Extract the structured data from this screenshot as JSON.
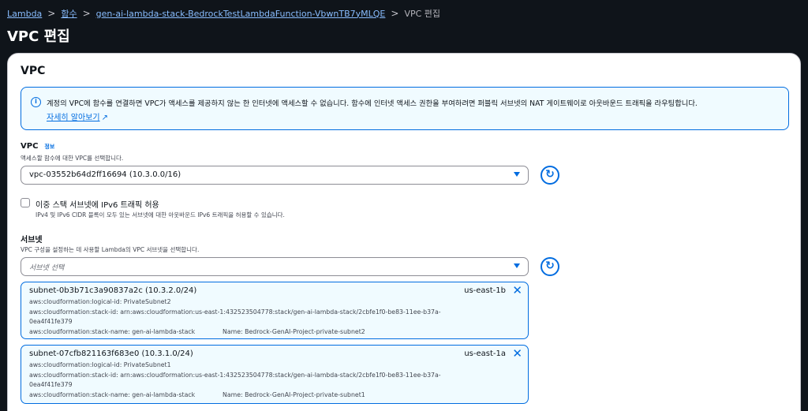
{
  "breadcrumb": {
    "items": [
      "Lambda",
      "함수",
      "gen-ai-lambda-stack-BedrockTestLambdaFunction-VbwnTB7yMLQE"
    ],
    "current": "VPC 편집"
  },
  "page": {
    "title": "VPC 편집"
  },
  "panel": {
    "title": "VPC",
    "alert": {
      "text": "계정의 VPC에 함수를 연결하면 VPC가 액세스를 제공하지 않는 한 인터넷에 액세스할 수 없습니다. 함수에 인터넷 액세스 권한을 부여하려면 퍼블릭 서브넷의 NAT 게이트웨이로 아웃바운드 트래픽을 라우팅합니다.",
      "link": "자세히 알아보기"
    },
    "vpc": {
      "label": "VPC",
      "info": "정보",
      "description": "액세스할 함수에 대한 VPC를 선택합니다.",
      "selected": "vpc-03552b64d2ff16694 (10.3.0.0/16)"
    },
    "ipv6": {
      "label": "이중 스택 서브넷에 IPv6 트래픽 허용",
      "description": "IPv4 및 IPv6 CIDR 블록이 모두 있는 서브넷에 대한 아웃바운드 IPv6 트래픽을 허용할 수 있습니다.",
      "checked": false
    },
    "subnets": {
      "label": "서브넷",
      "description": "VPC 구성을 설정하는 데 사용할 Lambda의 VPC 서브넷을 선택합니다.",
      "placeholder": "서브넷 선택",
      "items": [
        {
          "name": "subnet-0b3b71c3a90837a2c (10.3.2.0/24)",
          "az": "us-east-1b",
          "logical_id": "aws:cloudformation:logical-id: PrivateSubnet2",
          "stack_id_1": "aws:cloudformation:stack-id: arn:aws:cloudformation:us-east-1:432523504778:stack/gen-ai-lambda-stack/2cbfe1f0-be83-11ee-b37a-",
          "stack_id_2": "0ea4f41fe379",
          "stack_name": "aws:cloudformation:stack-name: gen-ai-lambda-stack",
          "name_tag": "Name: Bedrock-GenAI-Project-private-subnet2"
        },
        {
          "name": "subnet-07cfb821163f683e0 (10.3.1.0/24)",
          "az": "us-east-1a",
          "logical_id": "aws:cloudformation:logical-id: PrivateSubnet1",
          "stack_id_1": "aws:cloudformation:stack-id: arn:aws:cloudformation:us-east-1:432523504778:stack/gen-ai-lambda-stack/2cbfe1f0-be83-11ee-b37a-",
          "stack_id_2": "0ea4f41fe379",
          "stack_name": "aws:cloudformation:stack-name: gen-ai-lambda-stack",
          "name_tag": "Name: Bedrock-GenAI-Project-private-subnet1"
        }
      ]
    }
  },
  "icons": {
    "info": "info-circle-icon",
    "external": "external-link-icon",
    "caret": "caret-down-icon",
    "refresh": "refresh-icon",
    "remove": "close-icon"
  },
  "colors": {
    "header_bg": "#0f141a",
    "link": "#89bdff",
    "accent": "#006ce0",
    "alert_bg": "#f0fbff"
  }
}
